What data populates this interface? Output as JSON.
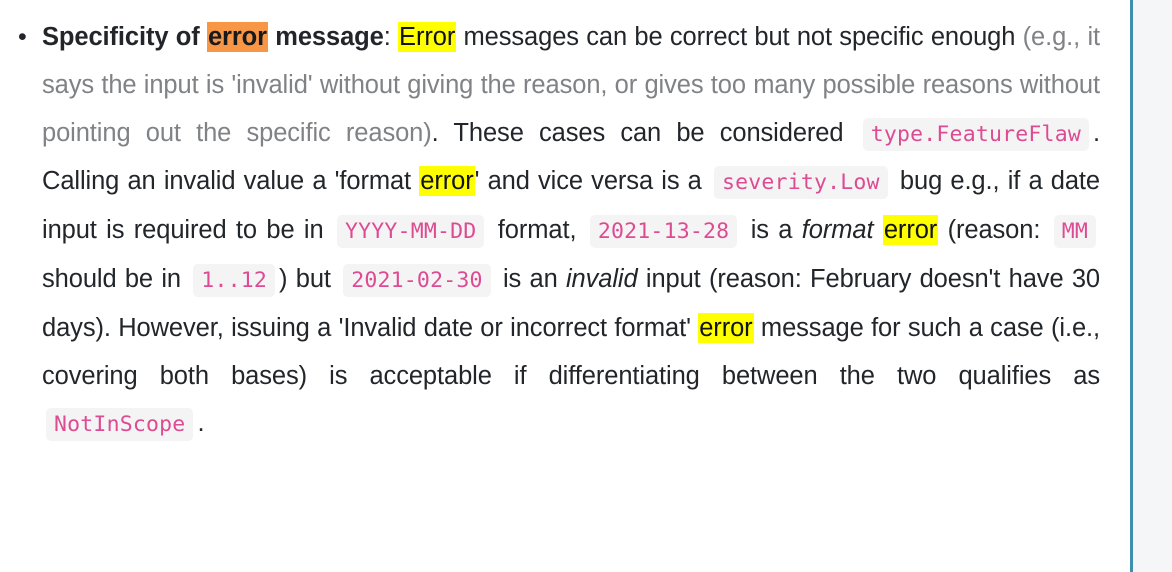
{
  "document": {
    "bullet_glyph": "•",
    "right_gutter": {
      "rule_color": "#3f8fb0",
      "panel_color": "#f4f6f8"
    },
    "colors": {
      "text": "#22262b",
      "muted_text": "#808285",
      "code_text": "#dd4b92",
      "code_background": "#f4f4f5",
      "highlight_yellow": "#ffff00",
      "highlight_orange": "#f79746",
      "accent_rule": "#3f8fb0"
    },
    "paragraph": {
      "lead_bold_1": "Specificity of ",
      "lead_highlight_orange": "error",
      "lead_bold_2": " message",
      "colon": ": ",
      "highlight_error_capital": "Error",
      "sentence_1": " messages can be correct but not specific enough ",
      "parenthetical_muted": "(e.g., it says the input is 'invalid' without giving the reason, or gives too many possible reasons without pointing out the specific reason)",
      "sentence_2": ". These cases can be considered ",
      "code_type_featureflaw": "type.FeatureFlaw",
      "sentence_3": ". Calling an invalid value a 'format ",
      "highlight_error_2": "error",
      "sentence_4": "' and vice versa is a ",
      "code_severity_low": "severity.Low",
      "sentence_5": " bug e.g., if a date input is required to be in ",
      "code_yyyy_mm_dd": "YYYY-MM-DD",
      "sentence_6": " format, ",
      "code_2021_13_28": "2021-13-28",
      "sentence_7": " is a ",
      "italic_format": "format",
      "space_1": " ",
      "highlight_error_3": "error",
      "sentence_8": " (reason: ",
      "code_mm": "MM",
      "sentence_9": " should be in ",
      "code_1_12": "1..12",
      "sentence_10": ") but ",
      "code_2021_02_30": "2021-02-30",
      "sentence_11": " is an ",
      "italic_invalid": "invalid",
      "sentence_12": " input (reason: February doesn't have 30 days). However, issuing a 'Invalid date or incorrect format' ",
      "highlight_error_4": "error",
      "sentence_13": " message for such a case (i.e., covering both bases) is acceptable if differentiating between the two qualifies as ",
      "code_notinscope": "NotInScope",
      "sentence_14": "."
    }
  }
}
